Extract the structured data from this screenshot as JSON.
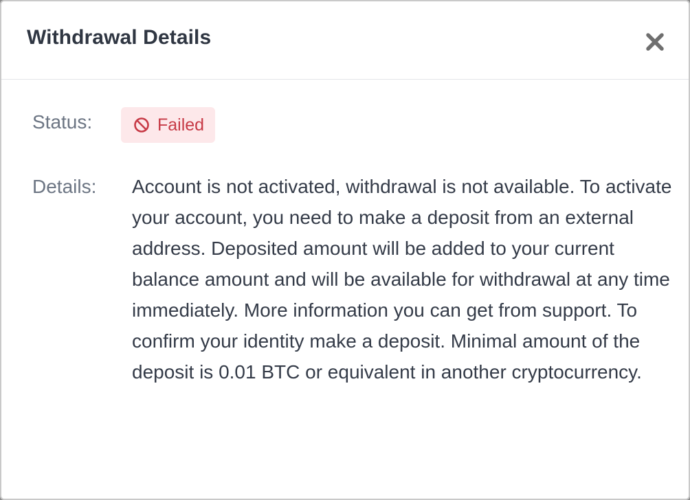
{
  "modal": {
    "title": "Withdrawal Details"
  },
  "status": {
    "label": "Status:",
    "value": "Failed",
    "icon": "ban-icon",
    "color": "#c73a46",
    "background": "#fde8ea"
  },
  "details": {
    "label": "Details:",
    "text": "Account is not activated, withdrawal is not available. To activate your account, you need to make a deposit from an external address. Deposited amount will be added to your current balance amount and will be available for withdrawal at any time immediately. More information you can get from support. To confirm your identity make a deposit. Minimal amount of the deposit is 0.01 BTC or equivalent in another cryptocurrency."
  },
  "icons": {
    "close": "close-icon"
  }
}
